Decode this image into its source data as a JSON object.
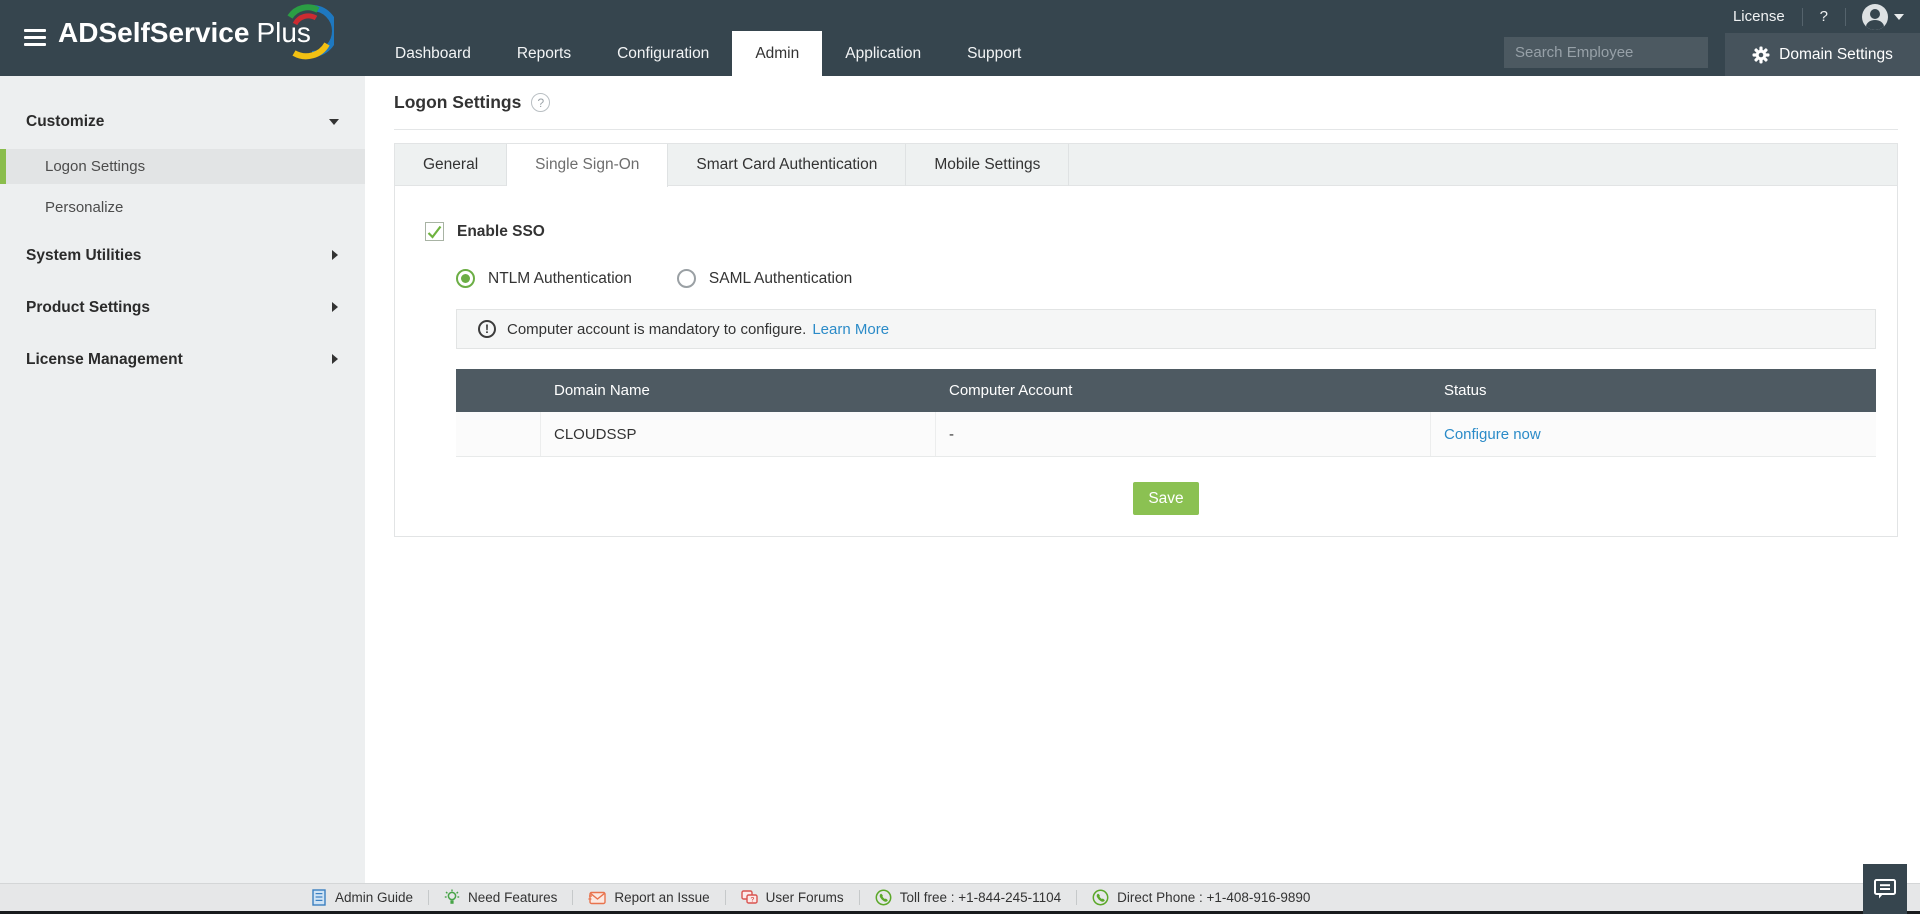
{
  "header": {
    "brand": {
      "name_bold": "ADSelfService",
      "name_light": "Plus"
    },
    "license_label": "License",
    "help_label": "?",
    "nav": [
      {
        "label": "Dashboard",
        "active": false
      },
      {
        "label": "Reports",
        "active": false
      },
      {
        "label": "Configuration",
        "active": false
      },
      {
        "label": "Admin",
        "active": true
      },
      {
        "label": "Application",
        "active": false
      },
      {
        "label": "Support",
        "active": false
      }
    ],
    "search": {
      "placeholder": "Search Employee"
    },
    "domain_settings_label": "Domain Settings"
  },
  "sidebar": {
    "customize": {
      "label": "Customize",
      "expanded": true
    },
    "customize_children": [
      {
        "label": "Logon Settings",
        "selected": true
      },
      {
        "label": "Personalize",
        "selected": false
      }
    ],
    "sections": [
      {
        "label": "System Utilities"
      },
      {
        "label": "Product Settings"
      },
      {
        "label": "License Management"
      }
    ]
  },
  "main": {
    "title": "Logon Settings",
    "help_badge": "?",
    "tabs": [
      {
        "label": "General",
        "active": false
      },
      {
        "label": "Single Sign-On",
        "active": true
      },
      {
        "label": "Smart Card Authentication",
        "active": false
      },
      {
        "label": "Mobile Settings",
        "active": false
      }
    ],
    "enable_sso_label": "Enable SSO",
    "enable_sso_checked": true,
    "auth_options": [
      {
        "label": "NTLM Authentication",
        "selected": true
      },
      {
        "label": "SAML Authentication",
        "selected": false
      }
    ],
    "notice": {
      "icon_glyph": "!",
      "text": "Computer account is mandatory to configure.",
      "link_label": "Learn More"
    },
    "table": {
      "columns": [
        "Domain Name",
        "Computer Account",
        "Status"
      ],
      "rows": [
        {
          "domain_name": "CLOUDSSP",
          "computer_account": "-",
          "status_link": "Configure now"
        }
      ]
    },
    "save_label": "Save"
  },
  "footer": {
    "links": [
      {
        "label": "Admin Guide",
        "icon": "book-icon"
      },
      {
        "label": "Need Features",
        "icon": "bulb-icon"
      },
      {
        "label": "Report an Issue",
        "icon": "mail-icon"
      },
      {
        "label": "User Forums",
        "icon": "forum-icon"
      }
    ],
    "contacts": [
      {
        "label": "Toll free : +1-844-245-1104",
        "icon": "phone-icon"
      },
      {
        "label": "Direct Phone : +1-408-916-9890",
        "icon": "phone-icon"
      }
    ]
  },
  "colors": {
    "header_bg": "#36454E",
    "accent_green": "#8BC152",
    "link_blue": "#2B8BC8",
    "table_header_bg": "#4E5A62",
    "sidebar_selected_accent": "#8ABD4C"
  }
}
